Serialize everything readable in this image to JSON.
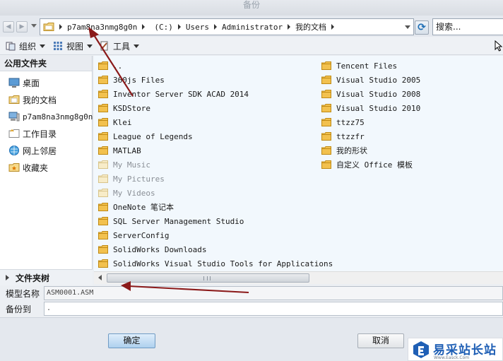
{
  "window": {
    "title": "备份"
  },
  "address": {
    "segments": [
      "p7am8na3nmg8g0n",
      "(C:)",
      "Users",
      "Administrator",
      "我的文档"
    ],
    "search_placeholder": "搜索..."
  },
  "toolbar": {
    "organize": "组织",
    "view": "视图",
    "tools": "工具"
  },
  "sidebar": {
    "header": "公用文件夹",
    "items": [
      {
        "label": "桌面",
        "icon": "desktop-icon"
      },
      {
        "label": "我的文档",
        "icon": "documents-icon"
      },
      {
        "label": "p7am8na3nmg8g0n",
        "icon": "computer-icon"
      },
      {
        "label": "工作目录",
        "icon": "working-directory-icon"
      },
      {
        "label": "网上邻居",
        "icon": "network-icon"
      },
      {
        "label": "收藏夹",
        "icon": "favorites-icon"
      }
    ],
    "footer": "文件夹树"
  },
  "files": {
    "col1": [
      {
        "name": "..",
        "dim": false
      },
      {
        "name": "360js Files",
        "dim": false
      },
      {
        "name": "Inventor Server SDK ACAD 2014",
        "dim": false
      },
      {
        "name": "KSDStore",
        "dim": false
      },
      {
        "name": "Klei",
        "dim": false
      },
      {
        "name": "League of Legends",
        "dim": false
      },
      {
        "name": "MATLAB",
        "dim": false
      },
      {
        "name": "My Music",
        "dim": true
      },
      {
        "name": "My Pictures",
        "dim": true
      },
      {
        "name": "My Videos",
        "dim": true
      },
      {
        "name": "OneNote 笔记本",
        "dim": false
      },
      {
        "name": "SQL Server Management Studio",
        "dim": false
      },
      {
        "name": "ServerConfig",
        "dim": false
      },
      {
        "name": "SolidWorks Downloads",
        "dim": false
      },
      {
        "name": "SolidWorks Visual Studio Tools for Applications",
        "dim": false
      }
    ],
    "col2": [
      {
        "name": "Tencent Files",
        "dim": false
      },
      {
        "name": "Visual Studio 2005",
        "dim": false
      },
      {
        "name": "Visual Studio 2008",
        "dim": false
      },
      {
        "name": "Visual Studio 2010",
        "dim": false
      },
      {
        "name": "ttzz75",
        "dim": false
      },
      {
        "name": "ttzzfr",
        "dim": false
      },
      {
        "name": "我的形状",
        "dim": false
      },
      {
        "name": "自定义 Office 模板",
        "dim": false
      }
    ]
  },
  "form": {
    "model_label": "模型名称",
    "model_value": "ASM0001.ASM",
    "backup_label": "备份到",
    "backup_value": "."
  },
  "buttons": {
    "ok": "确定",
    "cancel": "取消"
  },
  "watermark": {
    "text": "易采站长站",
    "sub": "Www.Easck.Com"
  },
  "colors": {
    "accent": "#1f5fb5",
    "annotation_arrow": "#8b1a1a",
    "folder": "#f2c14e"
  }
}
